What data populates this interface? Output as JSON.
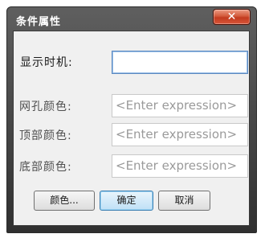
{
  "dialog": {
    "title": "条件属性",
    "close_glyph": "✕"
  },
  "form": {
    "rows": [
      {
        "label": "显示时机:",
        "value": "",
        "placeholder": ""
      },
      {
        "label": "网孔颜色:",
        "value": "",
        "placeholder": "<Enter expression>"
      },
      {
        "label": "顶部颜色:",
        "value": "",
        "placeholder": "<Enter expression>"
      },
      {
        "label": "底部颜色:",
        "value": "",
        "placeholder": "<Enter expression>"
      }
    ]
  },
  "buttons": {
    "color": "颜色...",
    "ok": "确定",
    "cancel": "取消"
  }
}
